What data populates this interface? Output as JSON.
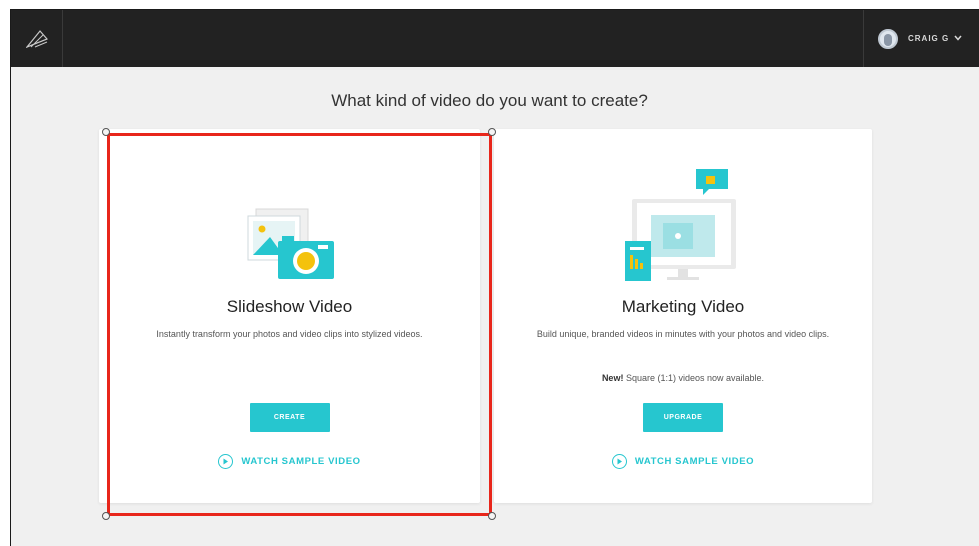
{
  "header": {
    "logo_icon": "origami-logo-icon",
    "user_name": "CRAIG G",
    "user_menu_icon": "chevron-down-icon"
  },
  "page": {
    "title": "What kind of video do you want to create?"
  },
  "cards": [
    {
      "title": "Slideshow Video",
      "description": "Instantly transform your photos and video clips into stylized videos.",
      "note": "",
      "button_label": "CREATE",
      "watch_label": "WATCH SAMPLE VIDEO",
      "selected": true
    },
    {
      "title": "Marketing Video",
      "description": "Build unique, branded videos in minutes with your photos and video clips.",
      "note_bold": "New!",
      "note": "Square (1:1) videos now available.",
      "button_label": "UPGRADE",
      "watch_label": "WATCH SAMPLE VIDEO",
      "selected": false
    }
  ],
  "colors": {
    "accent": "#26c6cf",
    "topbar": "#222222",
    "selection_border": "#e8261b",
    "background": "#f0f0f0"
  }
}
